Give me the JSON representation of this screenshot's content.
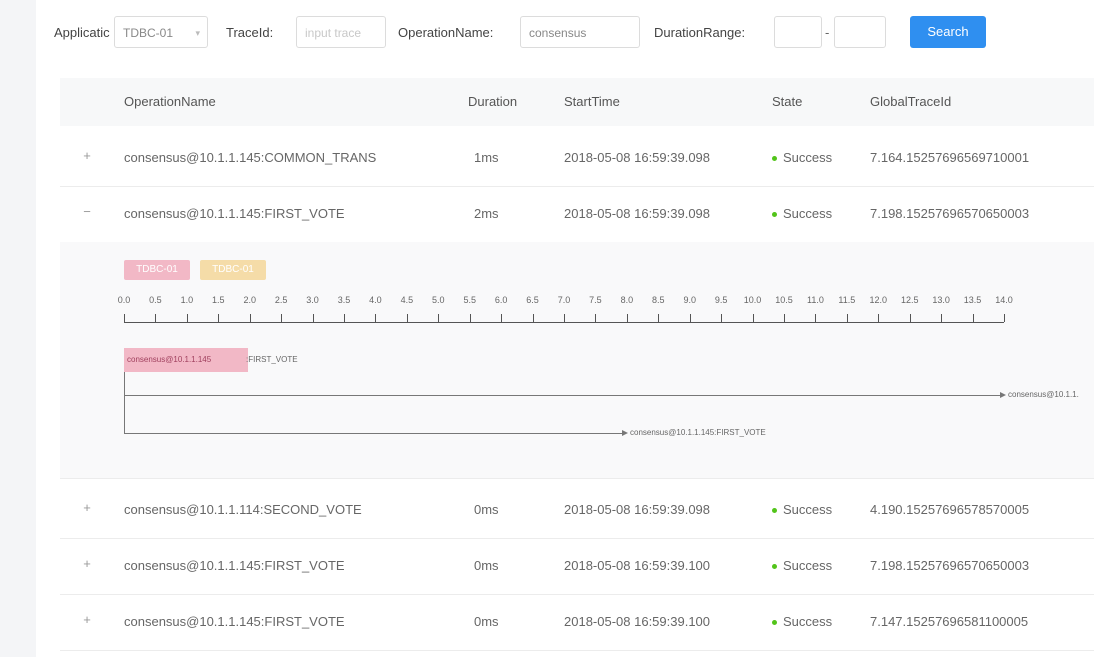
{
  "filter": {
    "application_label": "Applicatic",
    "application_value": "TDBC-01",
    "traceid_label": "TraceId:",
    "traceid_placeholder": "input trace",
    "operation_label": "OperationName:",
    "operation_value": "consensus",
    "duration_label": "DurationRange:",
    "duration_min": "",
    "duration_sep": "-",
    "duration_max": "",
    "search_label": "Search"
  },
  "table": {
    "headers": [
      "OperationName",
      "Duration",
      "StartTime",
      "State",
      "GlobalTraceId"
    ],
    "rows": [
      {
        "toggle": "+",
        "operation": "consensus@10.1.1.145:COMMON_TRANS",
        "duration": "1ms",
        "start": "2018-05-08 16:59:39.098",
        "state": "Success",
        "trace": "7.164.15257696569710001"
      },
      {
        "toggle": "−",
        "operation": "consensus@10.1.1.145:FIRST_VOTE",
        "duration": "2ms",
        "start": "2018-05-08 16:59:39.098",
        "state": "Success",
        "trace": "7.198.15257696570650003"
      },
      {
        "toggle": "+",
        "operation": "consensus@10.1.1.114:SECOND_VOTE",
        "duration": "0ms",
        "start": "2018-05-08 16:59:39.098",
        "state": "Success",
        "trace": "4.190.15257696578570005"
      },
      {
        "toggle": "+",
        "operation": "consensus@10.1.1.145:FIRST_VOTE",
        "duration": "0ms",
        "start": "2018-05-08 16:59:39.100",
        "state": "Success",
        "trace": "7.198.15257696570650003"
      },
      {
        "toggle": "+",
        "operation": "consensus@10.1.1.145:FIRST_VOTE",
        "duration": "0ms",
        "start": "2018-05-08 16:59:39.100",
        "state": "Success",
        "trace": "7.147.15257696581100005"
      }
    ]
  },
  "detail": {
    "legend": [
      {
        "label": "TDBC-01",
        "color": "#f2b8c6"
      },
      {
        "label": "TDBC-01",
        "color": "#f5dca8"
      }
    ],
    "ticks": [
      "0.0",
      "0.5",
      "1.0",
      "1.5",
      "2.0",
      "2.5",
      "3.0",
      "3.5",
      "4.0",
      "4.5",
      "5.0",
      "5.5",
      "6.0",
      "6.5",
      "7.0",
      "7.5",
      "8.0",
      "8.5",
      "9.0",
      "9.5",
      "10.0",
      "10.5",
      "11.0",
      "11.5",
      "12.0",
      "12.5",
      "13.0",
      "13.5",
      "14.0"
    ],
    "span_label_a": "consensus@10.1.1.145",
    "span_label_b": ":FIRST_VOTE",
    "edge1_label": "consensus@10.1.1.",
    "edge2_label": "consensus@10.1.1.145:FIRST_VOTE"
  },
  "colors": {
    "accent": "#2f8ff0",
    "success": "#52c41a",
    "span_pink": "#f2b8c6",
    "span_yellow": "#f5dca8"
  }
}
